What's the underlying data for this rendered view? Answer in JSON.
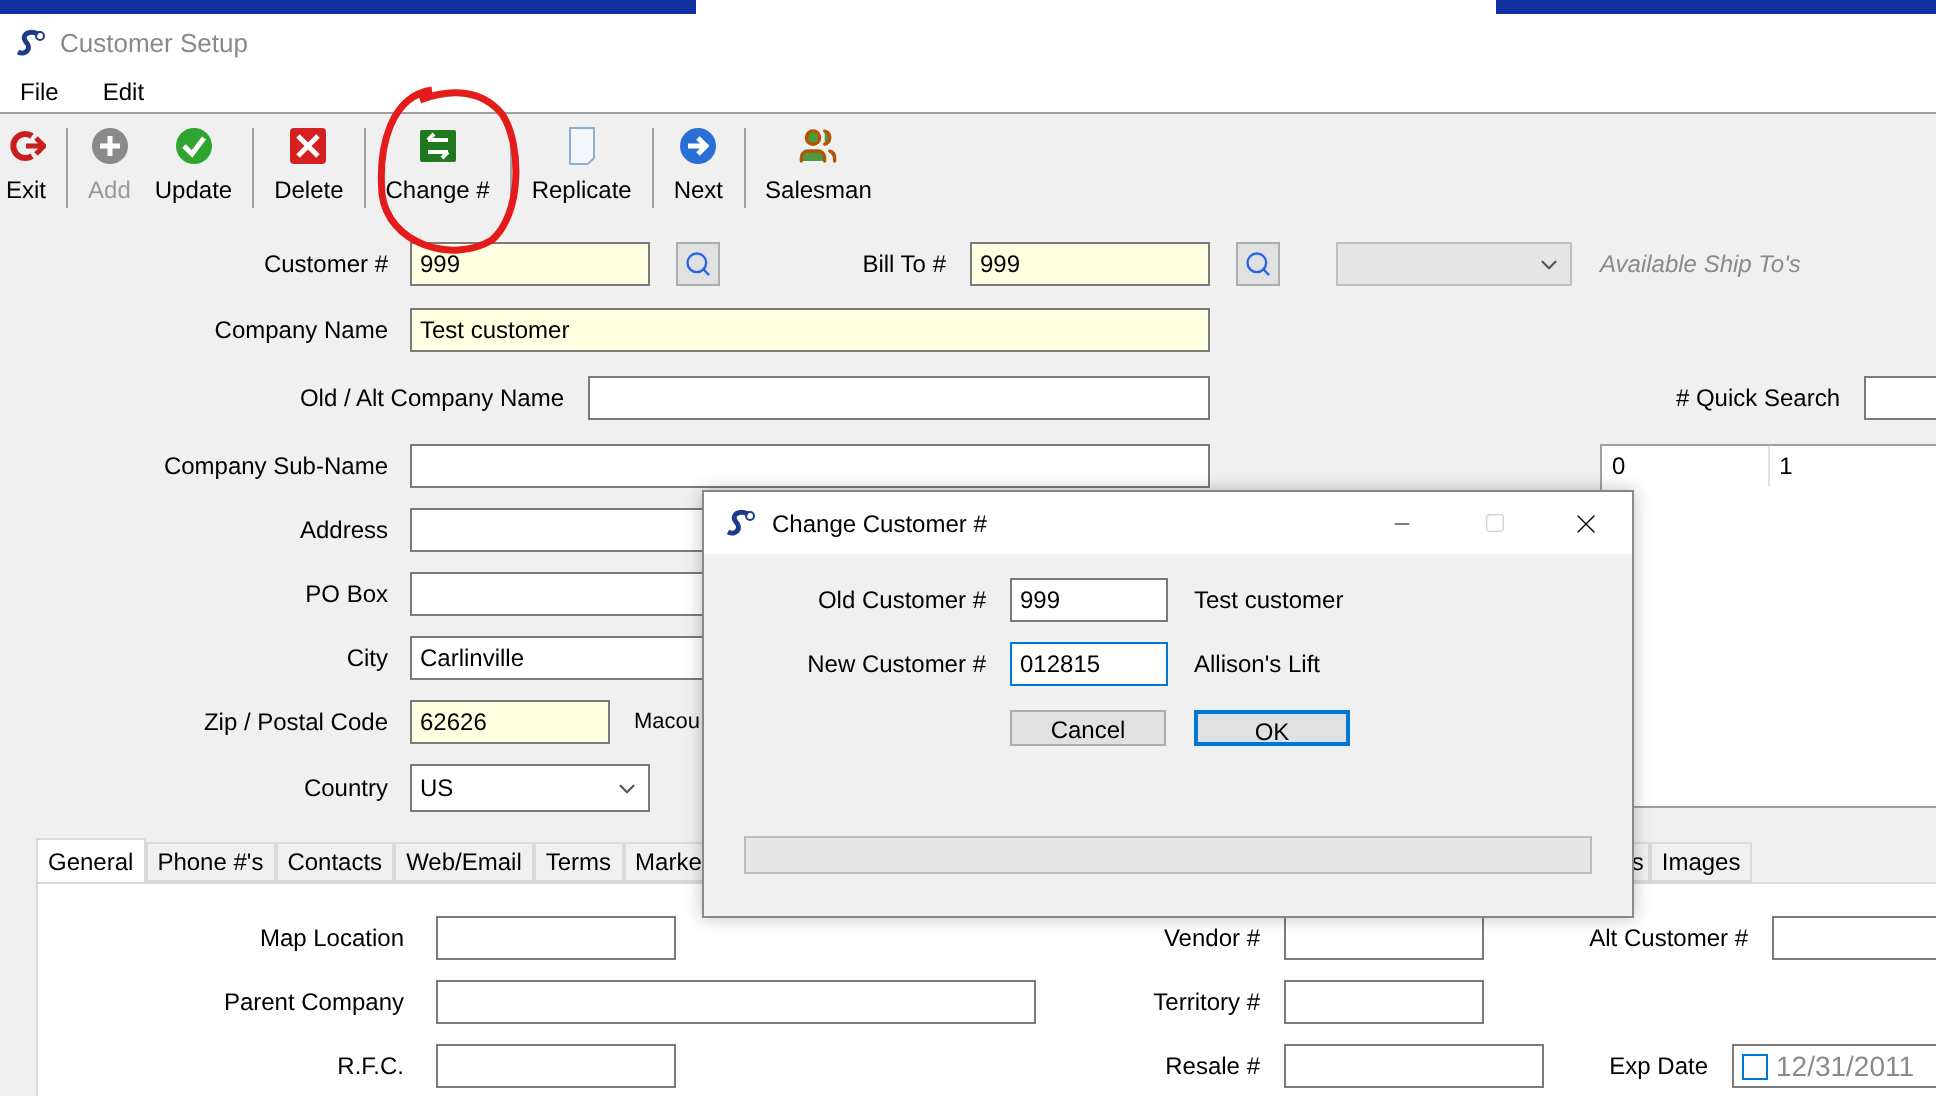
{
  "window": {
    "title": "Customer Setup"
  },
  "menu": [
    "File",
    "Edit"
  ],
  "toolbar": [
    [
      {
        "label": "Exit",
        "kind": "exit",
        "disabled": false
      }
    ],
    [
      {
        "label": "Add",
        "kind": "add",
        "disabled": true
      },
      {
        "label": "Update",
        "kind": "update",
        "disabled": false
      }
    ],
    [
      {
        "label": "Delete",
        "kind": "delete",
        "disabled": false
      }
    ],
    [
      {
        "label": "Change #",
        "kind": "change",
        "disabled": false
      }
    ],
    [
      {
        "label": "Replicate",
        "kind": "replicate",
        "disabled": false
      }
    ],
    [
      {
        "label": "Next",
        "kind": "next",
        "disabled": false
      }
    ],
    [
      {
        "label": "Salesman",
        "kind": "salesman",
        "disabled": false
      }
    ]
  ],
  "customer_number": {
    "label": "Customer #",
    "value": "999",
    "required": true
  },
  "bill_to": {
    "label": "Bill To #",
    "value": "999",
    "required": true
  },
  "ship_to": {
    "label": "Available Ship To's"
  },
  "company_name": {
    "label": "Company Name",
    "value": "Test customer",
    "required": true
  },
  "old_alt_company_name": {
    "label": "Old / Alt Company Name",
    "required": false
  },
  "quick_search": {
    "label": "# Quick Search"
  },
  "company_sub_name": {
    "label": "Company Sub-Name",
    "required": false
  },
  "address": {
    "label": "Address",
    "required": false
  },
  "po_box": {
    "label": "PO Box",
    "required": false
  },
  "city": {
    "label": "City",
    "value": "Carlinville",
    "required": false
  },
  "zip": {
    "label": "Zip / Postal Code",
    "value": "62626",
    "required": true,
    "county": "Macou"
  },
  "country": {
    "label": "Country",
    "value": "US"
  },
  "grid": {
    "columns": [
      "0",
      "1"
    ]
  },
  "tabs": [
    {
      "label": "General",
      "selected": true
    },
    {
      "label": "Phone #'s",
      "selected": false
    },
    {
      "label": "Contacts",
      "selected": false
    },
    {
      "label": "Web/Email",
      "selected": false
    },
    {
      "label": "Terms",
      "selected": false
    },
    {
      "label": "Marke",
      "selected": false
    },
    {
      "label": "s",
      "selected": false
    },
    {
      "label": "Images",
      "selected": false
    }
  ],
  "general": {
    "map_location": "Map Location",
    "parent_company": "Parent Company",
    "rfc": "R.F.C.",
    "vendor": "Vendor #",
    "territory": "Territory #",
    "resale": "Resale #",
    "alt_customer": "Alt Customer #",
    "exp_date": {
      "label": "Exp Date",
      "value": "12/31/2011",
      "checked": false
    }
  },
  "dialog": {
    "title": "Change Customer #",
    "rows": [
      {
        "label": "Old Customer #",
        "value": "999",
        "name": "Test customer",
        "focused": false
      },
      {
        "label": "New Customer #",
        "value": "012815",
        "name": "Allison's Lift",
        "focused": true
      }
    ],
    "buttons": [
      {
        "label": "Cancel",
        "default": false
      },
      {
        "label": "OK",
        "default": true
      }
    ],
    "progress": {
      "level": 0
    }
  }
}
